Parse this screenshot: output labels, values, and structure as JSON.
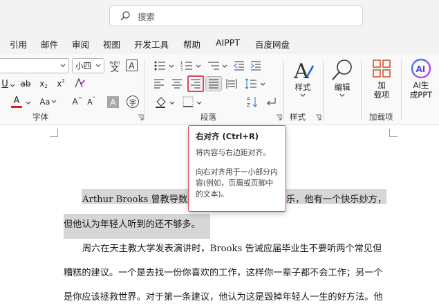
{
  "search": {
    "placeholder": "搜索"
  },
  "tabs": [
    "引用",
    "邮件",
    "审阅",
    "视图",
    "开发工具",
    "帮助",
    "AIPPT",
    "百度网盘"
  ],
  "ribbon": {
    "font_size_value": "小四",
    "wen_label_top": "wén",
    "wen_label_bottom": "文",
    "font_color": "#e21b1b",
    "group_font": "字体",
    "group_paragraph": "段落",
    "group_style": "样式",
    "group_addin": "加载项",
    "style_button": "样式",
    "edit_button": "编辑",
    "addin_button_line1": "加",
    "addin_button_line2": "载项",
    "ai_button_line1": "AI生",
    "ai_button_line2": "成PPT",
    "aa_label": "Aa",
    "a_label": "A",
    "abc_label": "ab",
    "x2_sub": "x",
    "x2_sup": "x",
    "highlight_color": "#e21b1b",
    "accent_red": "#e0435c"
  },
  "tooltip": {
    "title": "右对齐 (Ctrl+R)",
    "desc": "将内容与右边距对齐。",
    "more": "向右对齐用于一小部分内容(例如，页眉或页脚中的文本)。"
  },
  "document": {
    "lines": [
      "Arthur Brooks 曾教导数百",
      "乐，他有一个快乐妙方，",
      "但他认为年轻人听到的还不够多。",
      "周六在天主教大学发表演讲时，Brooks 告诫应届毕业生不要听两个常见但",
      "糟糕的建议。一个是去找一份你喜欢的工作，这样你一辈子都不会工作；另一个",
      "是你应该拯救世界。对于第一条建议，他认为这是毁掉年轻人一生的好方法。他"
    ]
  }
}
